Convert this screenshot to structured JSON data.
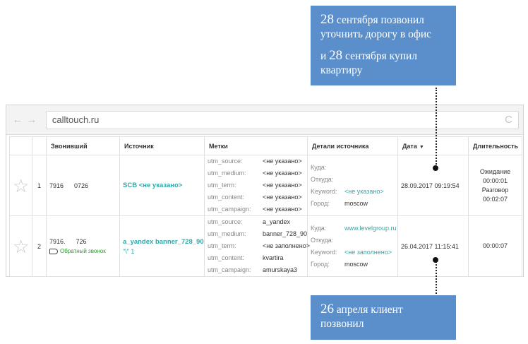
{
  "callouts": {
    "top": {
      "l1_num": "28",
      "l1_text": " сентября позвонил",
      "l2_text": "уточнить дорогу в офис",
      "l3_pre": "и ",
      "l3_num": "28",
      "l3_text": " сентября купил",
      "l4_text": "квартиру"
    },
    "bottom": {
      "l1_num": "26",
      "l1_text": " апреля клиент",
      "l2_text": "позвонил"
    }
  },
  "browser": {
    "back_icon": "←",
    "forward_icon": "→",
    "url": "calltouch.ru",
    "reload_icon": "C"
  },
  "table": {
    "headers": {
      "caller": "Звонивший",
      "source": "Источник",
      "tags": "Метки",
      "details": "Детали источника",
      "date": "Дата",
      "date_sort": "▼",
      "duration": "Длительность"
    },
    "rows": [
      {
        "num": "1",
        "caller": "7916      0726",
        "source": "SCB <не указано>",
        "tags": [
          {
            "k": "utm_source:",
            "v": "<не указано>"
          },
          {
            "k": "utm_medium:",
            "v": "<не указано>"
          },
          {
            "k": "utm_term:",
            "v": "<не указано>"
          },
          {
            "k": "utm_content:",
            "v": "<не указано>"
          },
          {
            "k": "utm_campaign:",
            "v": "<не указано>"
          }
        ],
        "details": [
          {
            "k": "Куда:",
            "v": ""
          },
          {
            "k": "Откуда:",
            "v": ""
          },
          {
            "k": "Keyword:",
            "v": "<не указано>"
          },
          {
            "k": "Город:",
            "v": "moscow"
          }
        ],
        "date": "28.09.2017 09:19:54",
        "duration": [
          "Ожидание",
          "00:00:01",
          "Разговор",
          "00:02:07"
        ]
      },
      {
        "num": "2",
        "caller": "7916.      726",
        "callback": "Обратный звонок",
        "source": "a_yandex banner_728_90",
        "source_sub": "\"\\\" 1",
        "tags": [
          {
            "k": "utm_source:",
            "v": "a_yandex"
          },
          {
            "k": "utm_medium:",
            "v": "banner_728_90"
          },
          {
            "k": "utm_term:",
            "v": "<не заполнено>"
          },
          {
            "k": "utm_content:",
            "v": "kvartira"
          },
          {
            "k": "utm_campaign:",
            "v": "amurskaya3"
          }
        ],
        "details": [
          {
            "k": "Куда:",
            "v": "www.levelgroup.ru"
          },
          {
            "k": "Откуда:",
            "v": ""
          },
          {
            "k": "Keyword:",
            "v": "<не заполнено>"
          },
          {
            "k": "Город:",
            "v": "moscow"
          }
        ],
        "date": "26.04.2017 11:15:41",
        "duration": [
          "00:00:07"
        ]
      }
    ]
  },
  "colors": {
    "callout": "#5b8fcb",
    "link": "#2fa8a8",
    "callback": "#2a9a2a"
  }
}
